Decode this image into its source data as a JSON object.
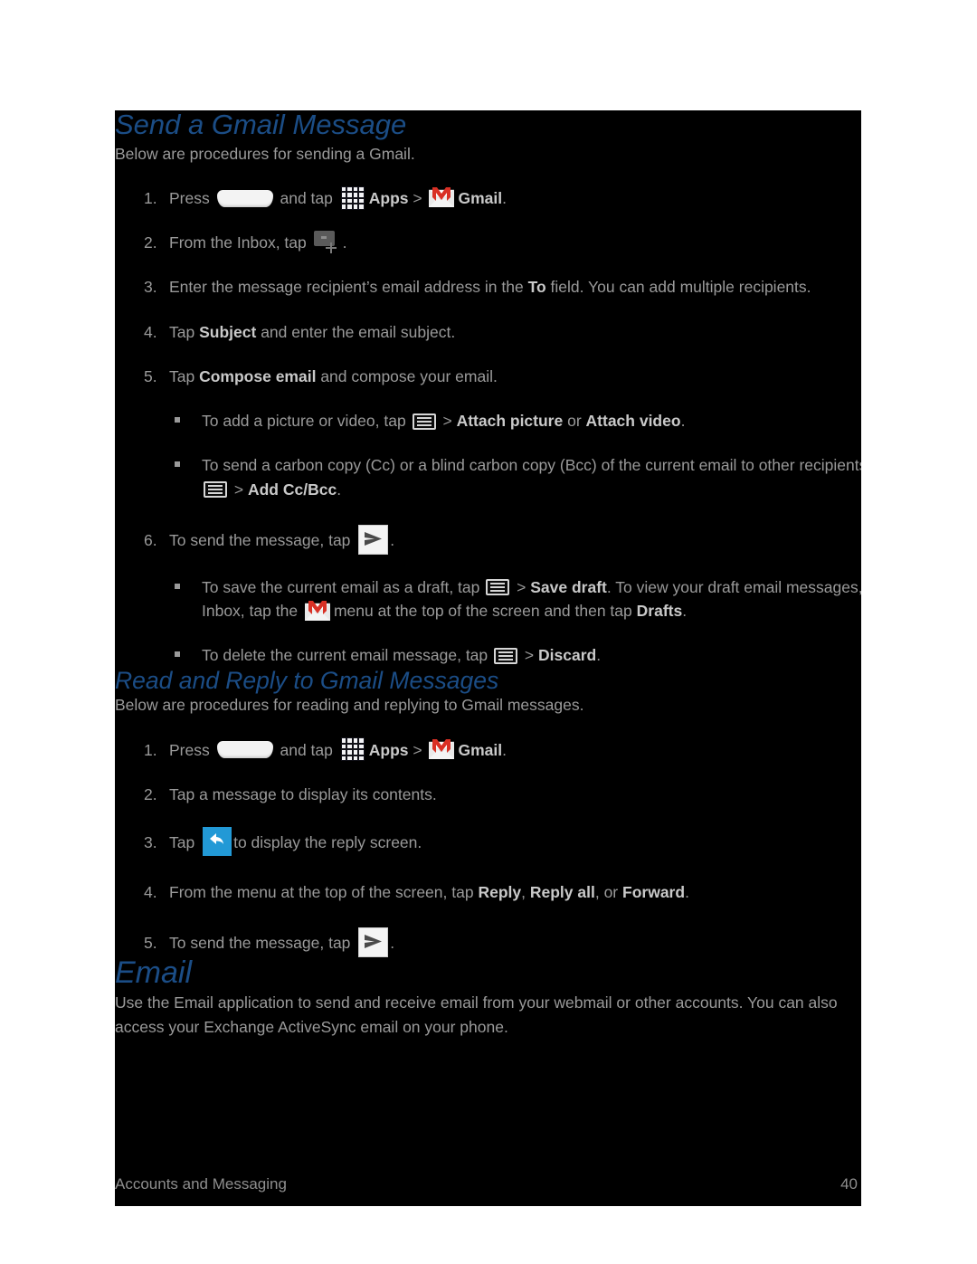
{
  "page": {
    "background": "#000000",
    "text_color": "#9a9a9a",
    "heading_color": "#1b4d86",
    "bold_color": "#c9c9c9",
    "reply_icon_color": "#2299d6",
    "gmail_m_color": "#d93025"
  },
  "sections": {
    "send_gmail": {
      "title": "Send a Gmail Message",
      "intro": "Below are procedures for sending a Gmail.",
      "steps": {
        "s1_num": "1.",
        "s1_a": "Press",
        "s1_b": "and tap",
        "s1_apps": "Apps",
        "s1_gt": ">",
        "s1_gmail": "Gmail",
        "s1_end": ".",
        "s2_num": "2.",
        "s2_a": "From the Inbox, tap",
        "s2_end": ".",
        "s3_num": "3.",
        "s3_a": "Enter the message recipient’s email address in the",
        "s3_to": "To",
        "s3_b": "field. You can add multiple recipients.",
        "s4_num": "4.",
        "s4_a": "Tap",
        "s4_subject": "Subject",
        "s4_b": "and enter the email subject.",
        "s5_num": "5.",
        "s5_a": "Tap",
        "s5_compose": "Compose email",
        "s5_b": "and compose your email.",
        "b1_a": "To add a picture or video, tap",
        "b1_gt": ">",
        "b1_attach_picture": "Attach picture",
        "b1_or": "or",
        "b1_attach_video": "Attach video",
        "b1_end": ".",
        "b2_a": "To send a carbon copy (Cc) or a blind carbon copy (Bcc) of the current email to other recipients, tap",
        "b2_gt": ">",
        "b2_addccbcc": "Add Cc/Bcc",
        "b2_end": ".",
        "s6_num": "6.",
        "s6_a": "To send the message, tap",
        "s6_end": ".",
        "b3_a": "To save the current email as a draft, tap",
        "b3_gt": ">",
        "b3_savedraft": "Save draft",
        "b3_b": ". To view your draft email messages, from the Inbox, tap the",
        "b3_c": "menu at the top of the screen and then tap",
        "b3_drafts": "Drafts",
        "b3_end": ".",
        "b4_a": "To delete the current email message, tap",
        "b4_gt": ">",
        "b4_discard": "Discard",
        "b4_end": "."
      }
    },
    "read_reply": {
      "title": "Read and Reply to Gmail Messages",
      "intro": "Below are procedures for reading and replying to Gmail messages.",
      "steps": {
        "s1_num": "1.",
        "s1_a": "Press",
        "s1_b": "and tap",
        "s1_apps": "Apps",
        "s1_gt": ">",
        "s1_gmail": "Gmail",
        "s1_end": ".",
        "s2_num": "2.",
        "s2_a": "Tap a message to display its contents.",
        "s3_num": "3.",
        "s3_a": "Tap",
        "s3_b": "to display the reply screen.",
        "s4_num": "4.",
        "s4_a": "From the menu at the top of the screen, tap",
        "s4_reply": "Reply",
        "s4_comma1": ",",
        "s4_replyall": "Reply all",
        "s4_or": ", or",
        "s4_forward": "Forward",
        "s4_end": ".",
        "s5_num": "5.",
        "s5_a": "To send the message, tap",
        "s5_end": "."
      }
    },
    "email": {
      "title": "Email",
      "body": "Use the Email application to send and receive email from your webmail or other accounts. You can also access your Exchange ActiveSync email on your phone."
    }
  },
  "footer": {
    "left": "Accounts and Messaging",
    "page_number": "40"
  },
  "icons": {
    "home_key": "home-key-icon",
    "apps": "apps-grid-icon",
    "gmail": "gmail-envelope-icon",
    "compose": "compose-new-icon",
    "menu": "menu-icon",
    "send": "send-icon",
    "reply": "reply-icon"
  }
}
